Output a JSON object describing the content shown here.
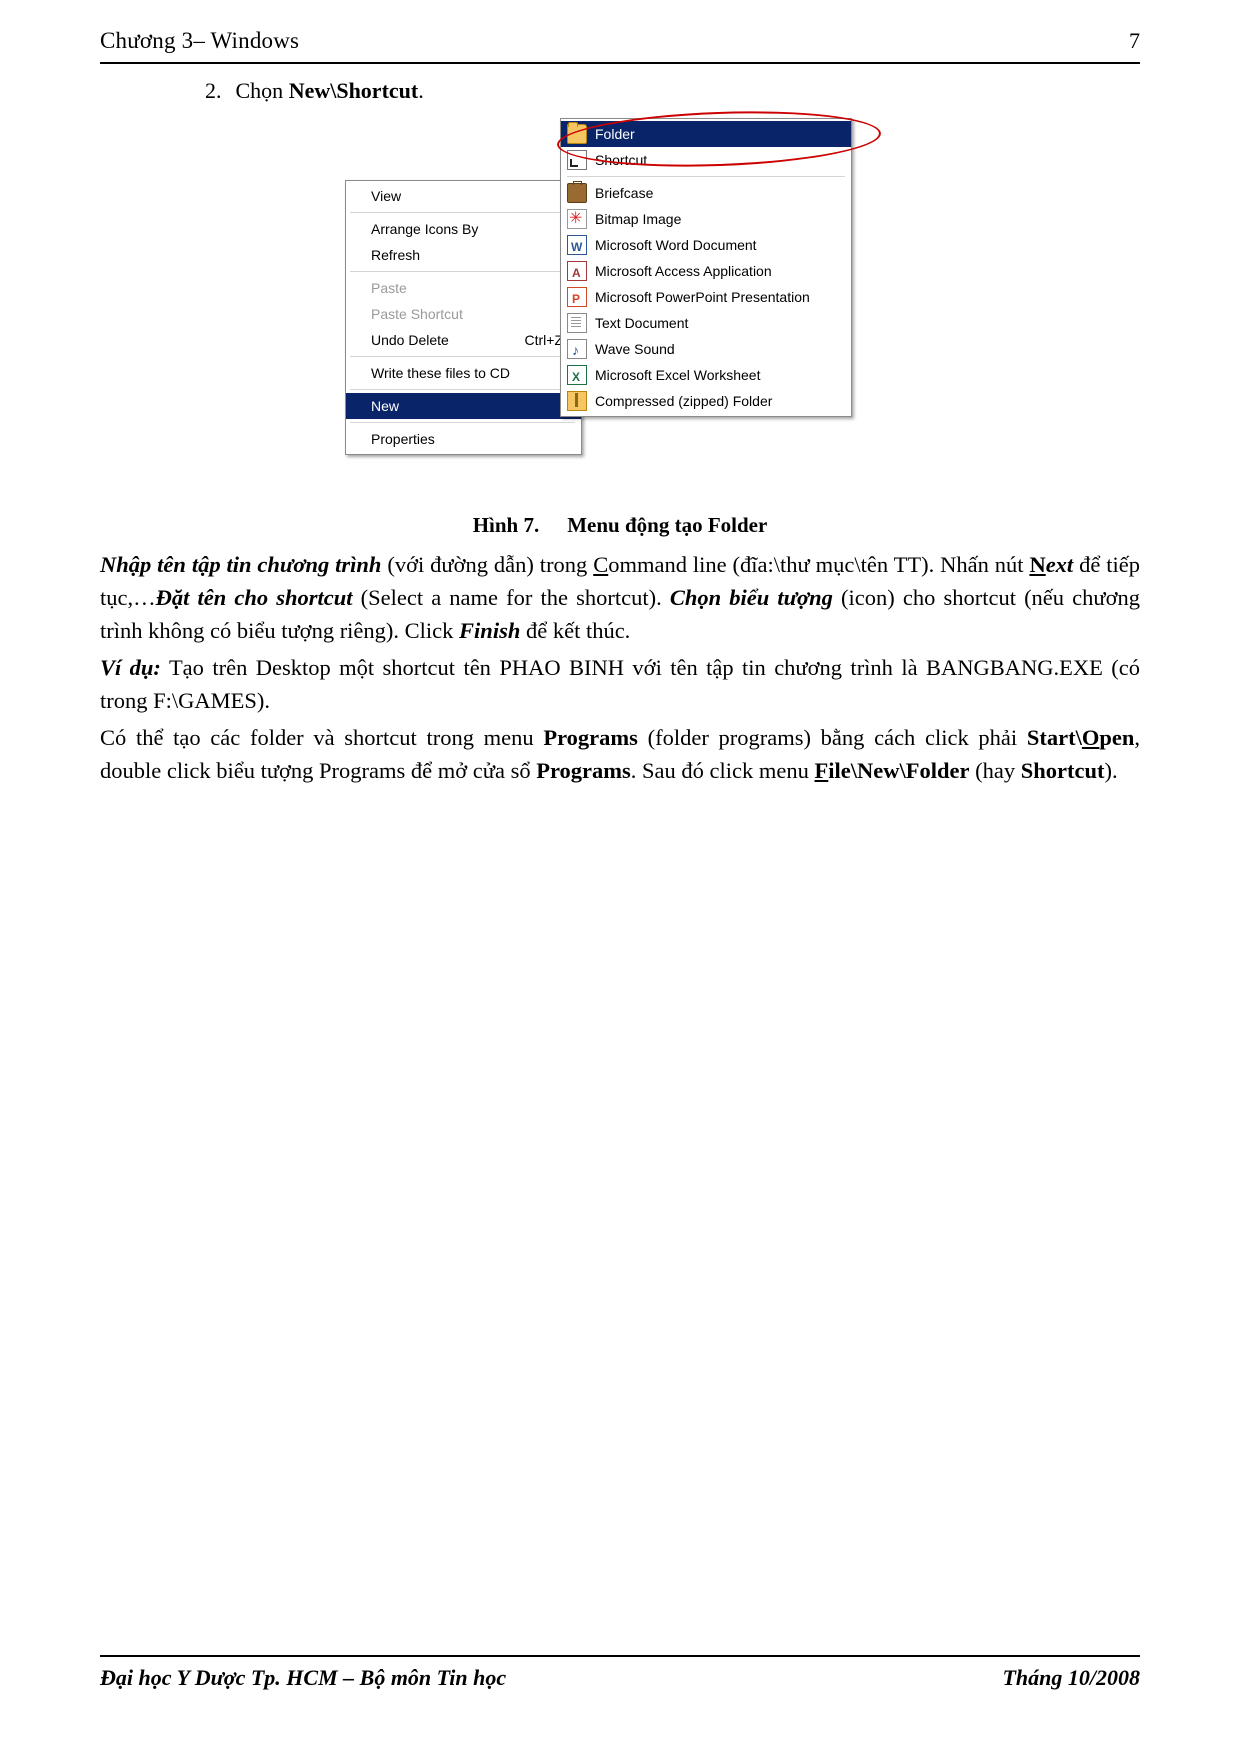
{
  "header": {
    "left": "Chương 3– Windows",
    "page_number": "7"
  },
  "step": {
    "number": "2.",
    "text_before": "Chọn ",
    "bold": "New\\Shortcut",
    "text_after": "."
  },
  "figure": {
    "context_menu": [
      {
        "label": "View",
        "submenu": true,
        "disabled": false,
        "accel": ""
      },
      {
        "sep": true
      },
      {
        "label": "Arrange Icons By",
        "submenu": true,
        "disabled": false,
        "accel": ""
      },
      {
        "label": "Refresh",
        "submenu": false,
        "disabled": false,
        "accel": ""
      },
      {
        "sep": true
      },
      {
        "label": "Paste",
        "submenu": false,
        "disabled": true,
        "accel": ""
      },
      {
        "label": "Paste Shortcut",
        "submenu": false,
        "disabled": true,
        "accel": ""
      },
      {
        "label": "Undo Delete",
        "submenu": false,
        "disabled": false,
        "accel": "Ctrl+Z"
      },
      {
        "sep": true
      },
      {
        "label": "Write these files to CD",
        "submenu": false,
        "disabled": false,
        "accel": ""
      },
      {
        "sep": true
      },
      {
        "label": "New",
        "submenu": true,
        "disabled": false,
        "accel": "",
        "selected": true
      },
      {
        "sep": true
      },
      {
        "label": "Properties",
        "submenu": false,
        "disabled": false,
        "accel": ""
      }
    ],
    "submenu": [
      {
        "label": "Folder",
        "icon": "folder-icon",
        "selected": true,
        "underline_index": 0
      },
      {
        "label": "Shortcut",
        "icon": "shortcut-icon",
        "selected": false,
        "underline_index": 0
      },
      {
        "sep": true
      },
      {
        "label": "Briefcase",
        "icon": "briefcase-icon",
        "selected": false
      },
      {
        "label": "Bitmap Image",
        "icon": "bitmap-image-icon",
        "selected": false
      },
      {
        "label": "Microsoft Word Document",
        "icon": "word-document-icon",
        "selected": false
      },
      {
        "label": "Microsoft Access Application",
        "icon": "access-application-icon",
        "selected": false
      },
      {
        "label": "Microsoft PowerPoint Presentation",
        "icon": "powerpoint-presentation-icon",
        "selected": false
      },
      {
        "label": "Text Document",
        "icon": "text-document-icon",
        "selected": false
      },
      {
        "label": "Wave Sound",
        "icon": "wave-sound-icon",
        "selected": false
      },
      {
        "label": "Microsoft Excel Worksheet",
        "icon": "excel-worksheet-icon",
        "selected": false
      },
      {
        "label": "Compressed (zipped) Folder",
        "icon": "zipped-folder-icon",
        "selected": false
      }
    ],
    "annotation_color": "#cc0000"
  },
  "caption": {
    "label": "Hình 7.",
    "text": "Menu động tạo Folder"
  },
  "paragraphs": {
    "p1": {
      "s1": "Nhập tên tập tin chương trình",
      "s2": " (với đường dẫn) trong ",
      "s3": "C",
      "s4": "ommand line (đĩa:\\thư mục\\tên TT). Nhấn nút ",
      "s5": "N",
      "s6": "ext",
      "s7": " để tiếp tục,…",
      "s8": "Đặt tên cho shortcut",
      "s9": " (Select a name for the shortcut). ",
      "s10": "Chọn biểu tượng",
      "s11": " (icon) cho shortcut (nếu chương trình không có biểu tượng riêng). Click ",
      "s12": "Finish",
      "s13": " để kết thúc."
    },
    "p2": {
      "s1": "Ví dụ:",
      "s2": " Tạo trên Desktop một shortcut tên PHAO BINH với tên tập tin chương trình là BANGBANG.EXE (có trong F:\\GAMES)."
    },
    "p3": {
      "s1": "Có thể tạo các folder và shortcut trong menu ",
      "s2": "Programs",
      "s3": " (folder programs) bằng cách click phải ",
      "s4": "Start\\",
      "s5": "O",
      "s6": "pen",
      "s7": ", double click biểu tượng Programs để mở cửa sổ ",
      "s8": "Programs",
      "s9": ". Sau đó click menu ",
      "s10": "F",
      "s11": "ile\\New\\Folder",
      "s12": " (hay ",
      "s13": "Shortcut",
      "s14": ")."
    }
  },
  "footer": {
    "left": "Đại học Y Dược Tp. HCM – Bộ môn Tin học",
    "right": "Tháng 10/2008"
  }
}
